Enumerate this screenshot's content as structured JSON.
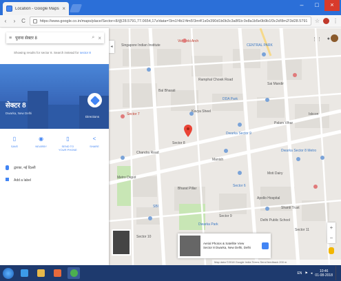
{
  "browser": {
    "tab_title": "Location - Google Maps",
    "tab_close": "×",
    "url": "https://www.google.co.in/maps/place/Sector+8/@28.5791,77.0654,17z/data=!3m1!4b1!4m5!3m4!1s0x390d1b0b3c3a8f1b:0x8a1b5e0b9b1f3c2d!8m2!3d28.5791!4d77.0676",
    "nav_back": "‹",
    "nav_forward": "›",
    "nav_reload": "C",
    "window_controls": {
      "minimize": "–",
      "maximize": "□",
      "close": "×"
    }
  },
  "panel": {
    "search_value": "पुराना सेक्टर 8",
    "hint_text": "Showing results for sector 8. Search instead for",
    "hint_link": "sector 8",
    "place_name": "सेक्टर 8",
    "place_subtitle": "Dwarka, New Delhi",
    "directions_label": "Directions",
    "actions": [
      {
        "icon": "save-icon",
        "glyph": "▯",
        "label": "SAVE"
      },
      {
        "icon": "nearby-icon",
        "glyph": "◉",
        "label": "NEARBY"
      },
      {
        "icon": "send-icon",
        "glyph": "▯",
        "label": "SEND TO YOUR PHONE"
      },
      {
        "icon": "share-icon",
        "glyph": "<",
        "label": "SHARE"
      }
    ],
    "info": [
      {
        "icon": "location-pin-icon",
        "text": "द्वारका, नई दिल्ली"
      },
      {
        "icon": "plus-code-icon",
        "text": "Add a label"
      }
    ]
  },
  "map": {
    "labels": [
      {
        "text": "Singapore Indian Institute",
        "cls": "",
        "pos": "l1"
      },
      {
        "text": "Vidyanki Arch",
        "cls": "red",
        "pos": "l2"
      },
      {
        "text": "CENTRAL PARK",
        "cls": "blue",
        "pos": "l3"
      },
      {
        "text": "Bal Bharati",
        "cls": "",
        "pos": "l4"
      },
      {
        "text": "Ramphal Chowk Road",
        "cls": "",
        "pos": "l5"
      },
      {
        "text": "Sai Mandir",
        "cls": "",
        "pos": "l6"
      },
      {
        "text": "Sector 7",
        "cls": "red",
        "pos": "l7"
      },
      {
        "text": "Kavya Sheel",
        "cls": "",
        "pos": "l8"
      },
      {
        "text": "Sector 8",
        "cls": "",
        "pos": "l9"
      },
      {
        "text": "DDA Park",
        "cls": "blue",
        "pos": "l10"
      },
      {
        "text": "Palam Vihar",
        "cls": "",
        "pos": "l11"
      },
      {
        "text": "Iskcon",
        "cls": "",
        "pos": "l12"
      },
      {
        "text": "Dwarka Sector 9",
        "cls": "blue",
        "pos": "l13"
      },
      {
        "text": "Chandra Road",
        "cls": "",
        "pos": "l14"
      },
      {
        "text": "Dwarka Sector 8 Metro",
        "cls": "blue",
        "pos": "l15"
      },
      {
        "text": "Manish",
        "cls": "",
        "pos": "l16"
      },
      {
        "text": "Moti Dairy",
        "cls": "",
        "pos": "l17"
      },
      {
        "text": "Metro Depot",
        "cls": "",
        "pos": "l18"
      },
      {
        "text": "Bharat Pillar",
        "cls": "",
        "pos": "l19"
      },
      {
        "text": "Sector 6",
        "cls": "blue",
        "pos": "l20"
      },
      {
        "text": "Apollo Hospital",
        "cls": "",
        "pos": "l21"
      },
      {
        "text": "SBI",
        "cls": "blue",
        "pos": "l22"
      },
      {
        "text": "Shanti Trust",
        "cls": "",
        "pos": "l23"
      },
      {
        "text": "Sector 9",
        "cls": "",
        "pos": "l24"
      },
      {
        "text": "Delhi Public School",
        "cls": "",
        "pos": "l25"
      },
      {
        "text": "Dwarka Park",
        "cls": "blue",
        "pos": "l26"
      },
      {
        "text": "Sector 11",
        "cls": "",
        "pos": "l27"
      },
      {
        "text": "Sector 10",
        "cls": "",
        "pos": "l28"
      }
    ],
    "thumb_title": "Aerial Photos & Satellite View",
    "thumb_sub": "Sector 8 Dwarka, New Delhi, Delhi",
    "footer": "Map data ©2018 Google  India  Terms  Send feedback  200 m",
    "zoom_in": "+",
    "zoom_out": "−"
  },
  "taskbar": {
    "items": [
      {
        "icon": "ie-icon",
        "color": "#3c9be8"
      },
      {
        "icon": "folder-icon",
        "color": "#e8b84a"
      },
      {
        "icon": "media-player-icon",
        "color": "#e86a3c"
      },
      {
        "icon": "chrome-icon",
        "color": "#4caf50"
      }
    ],
    "lang": "EN",
    "time": "10:46",
    "date": "01-08-2018"
  }
}
